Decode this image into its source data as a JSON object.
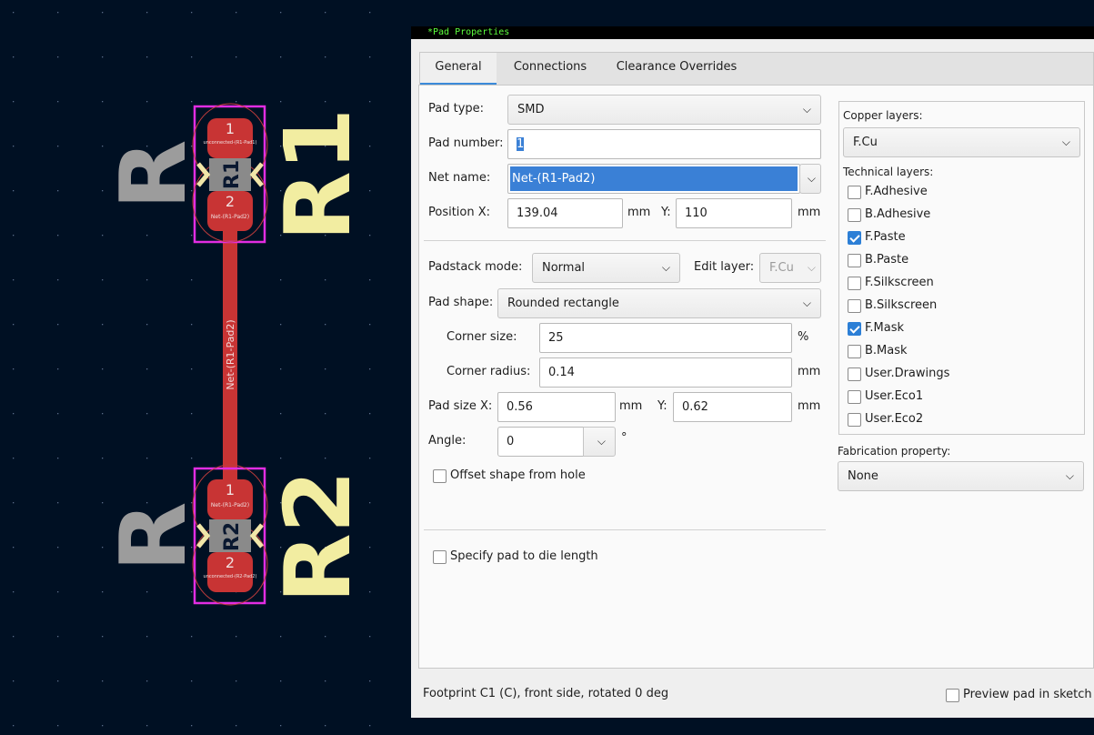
{
  "pcb": {
    "r1": {
      "ref": "R1",
      "value": "R",
      "pad1_num": "1",
      "pad2_num": "2",
      "pad1_net": "unconnected-(R1-Pad1)",
      "pad2_net": "Net-(R1-Pad2)"
    },
    "r2": {
      "ref": "R2",
      "value": "R",
      "pad1_num": "1",
      "pad2_num": "2",
      "pad1_net": "Net-(R1-Pad2)",
      "pad2_net": "unconnected-(R2-Pad2)"
    },
    "track_net": "Net-(R1-Pad2)"
  },
  "dialog": {
    "title": "*Pad Properties",
    "tabs": [
      "General",
      "Connections",
      "Clearance Overrides"
    ],
    "pad_type": {
      "label": "Pad type:",
      "value": "SMD"
    },
    "pad_number": {
      "label": "Pad number:",
      "value": "1"
    },
    "net_name": {
      "label": "Net name:",
      "value": "Net-(R1-Pad2)"
    },
    "position": {
      "label_x": "Position X:",
      "x": "139.04",
      "unit_x": "mm",
      "label_y": "Y:",
      "y": "110",
      "unit_y": "mm"
    },
    "padstack_mode": {
      "label": "Padstack mode:",
      "value": "Normal"
    },
    "edit_layer": {
      "label": "Edit layer:",
      "value": "F.Cu"
    },
    "pad_shape": {
      "label": "Pad shape:",
      "value": "Rounded rectangle"
    },
    "corner_size": {
      "label": "Corner size:",
      "value": "25",
      "unit": "%"
    },
    "corner_radius": {
      "label": "Corner radius:",
      "value": "0.14",
      "unit": "mm"
    },
    "pad_size": {
      "label_x": "Pad size X:",
      "x": "0.56",
      "unit_x": "mm",
      "label_y": "Y:",
      "y": "0.62",
      "unit_y": "mm"
    },
    "angle": {
      "label": "Angle:",
      "value": "0",
      "unit": "°"
    },
    "offset_shape": {
      "label": "Offset shape from hole",
      "checked": false
    },
    "die_length": {
      "label": "Specify pad to die length",
      "checked": false
    },
    "copper_layers": {
      "label": "Copper layers:",
      "value": "F.Cu"
    },
    "technical_layers": {
      "label": "Technical layers:",
      "items": [
        {
          "name": "F.Adhesive",
          "checked": false
        },
        {
          "name": "B.Adhesive",
          "checked": false
        },
        {
          "name": "F.Paste",
          "checked": true
        },
        {
          "name": "B.Paste",
          "checked": false
        },
        {
          "name": "F.Silkscreen",
          "checked": false
        },
        {
          "name": "B.Silkscreen",
          "checked": false
        },
        {
          "name": "F.Mask",
          "checked": true
        },
        {
          "name": "B.Mask",
          "checked": false
        },
        {
          "name": "User.Drawings",
          "checked": false
        },
        {
          "name": "User.Eco1",
          "checked": false
        },
        {
          "name": "User.Eco2",
          "checked": false
        }
      ]
    },
    "fabrication": {
      "label": "Fabrication property:",
      "value": "None"
    },
    "footer": {
      "status": "Footprint C1 (C), front side, rotated 0 deg",
      "preview_label": "Preview pad in sketch",
      "preview_checked": false
    }
  }
}
